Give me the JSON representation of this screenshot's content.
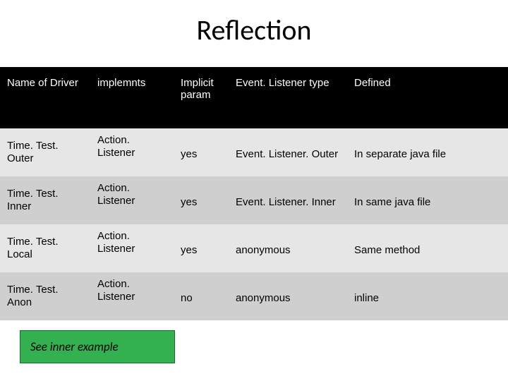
{
  "title": "Reflection",
  "headers": {
    "c1": "Name of Driver",
    "c2": "implemnts",
    "c3": "Implicit param",
    "c4": "Event. Listener type",
    "c5": "Defined"
  },
  "rows": [
    {
      "name": "Time. Test. Outer",
      "implements": "Action. Listener",
      "implicit": "yes",
      "type": "Event. Listener. Outer",
      "defined": "In separate java file"
    },
    {
      "name": "Time. Test. Inner",
      "implements": "Action. Listener",
      "implicit": "yes",
      "type": "Event. Listener. Inner",
      "defined": "In same java file"
    },
    {
      "name": "Time. Test. Local",
      "implements": "Action. Listener",
      "implicit": "yes",
      "type": "anonymous",
      "defined": "Same method"
    },
    {
      "name": "Time. Test. Anon",
      "implements": "Action. Listener",
      "implicit": "no",
      "type": "anonymous",
      "defined": "inline"
    }
  ],
  "link": "See inner example",
  "chart_data": {
    "type": "table",
    "title": "Reflection",
    "columns": [
      "Name of Driver",
      "implemnts",
      "Implicit param",
      "Event. Listener type",
      "Defined"
    ],
    "rows": [
      [
        "Time. Test. Outer",
        "Action. Listener",
        "yes",
        "Event. Listener. Outer",
        "In separate java file"
      ],
      [
        "Time. Test. Inner",
        "Action. Listener",
        "yes",
        "Event. Listener. Inner",
        "In same java file"
      ],
      [
        "Time. Test. Local",
        "Action. Listener",
        "yes",
        "anonymous",
        "Same method"
      ],
      [
        "Time. Test. Anon",
        "Action. Listener",
        "no",
        "anonymous",
        "inline"
      ]
    ]
  }
}
